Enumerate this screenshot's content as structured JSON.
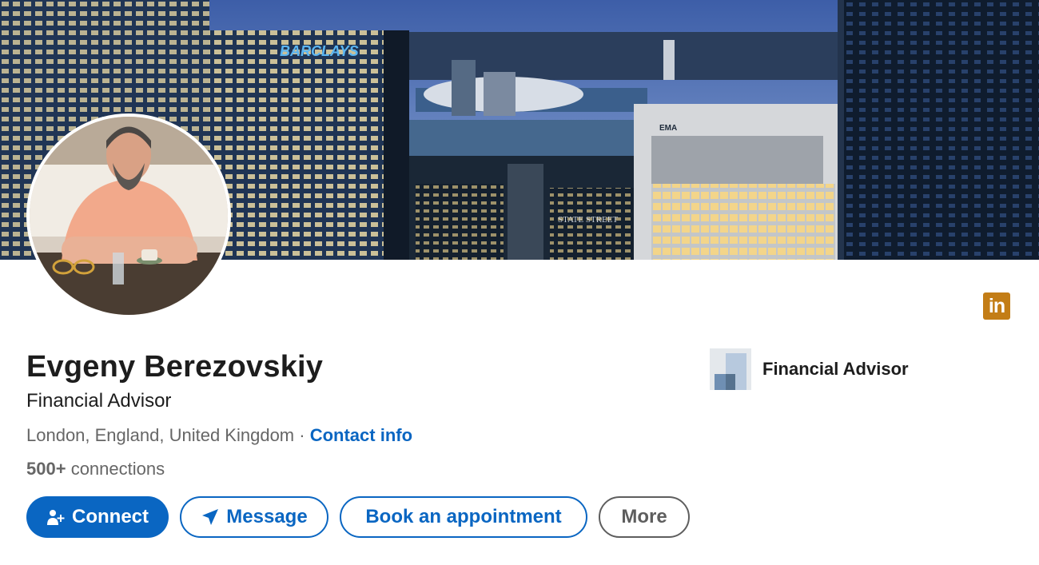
{
  "banner": {
    "signs": [
      "BARCLAYS",
      "EMA",
      "STATE STREET"
    ]
  },
  "profile": {
    "name": "Evgeny Berezovskiy",
    "headline": "Financial Advisor",
    "location": "London, England, United Kingdom",
    "separator": "·",
    "contact_label": "Contact info",
    "connections_count": "500+",
    "connections_label": "connections"
  },
  "company": {
    "name": "Financial Advisor"
  },
  "linkedin_badge": {
    "label": "in",
    "color": "#c37d16"
  },
  "actions": {
    "connect_label": "Connect",
    "message_label": "Message",
    "book_label": "Book an appointment",
    "more_label": "More"
  },
  "colors": {
    "accent": "#0a66c2",
    "text": "#1d1d1d",
    "muted": "#666666"
  }
}
